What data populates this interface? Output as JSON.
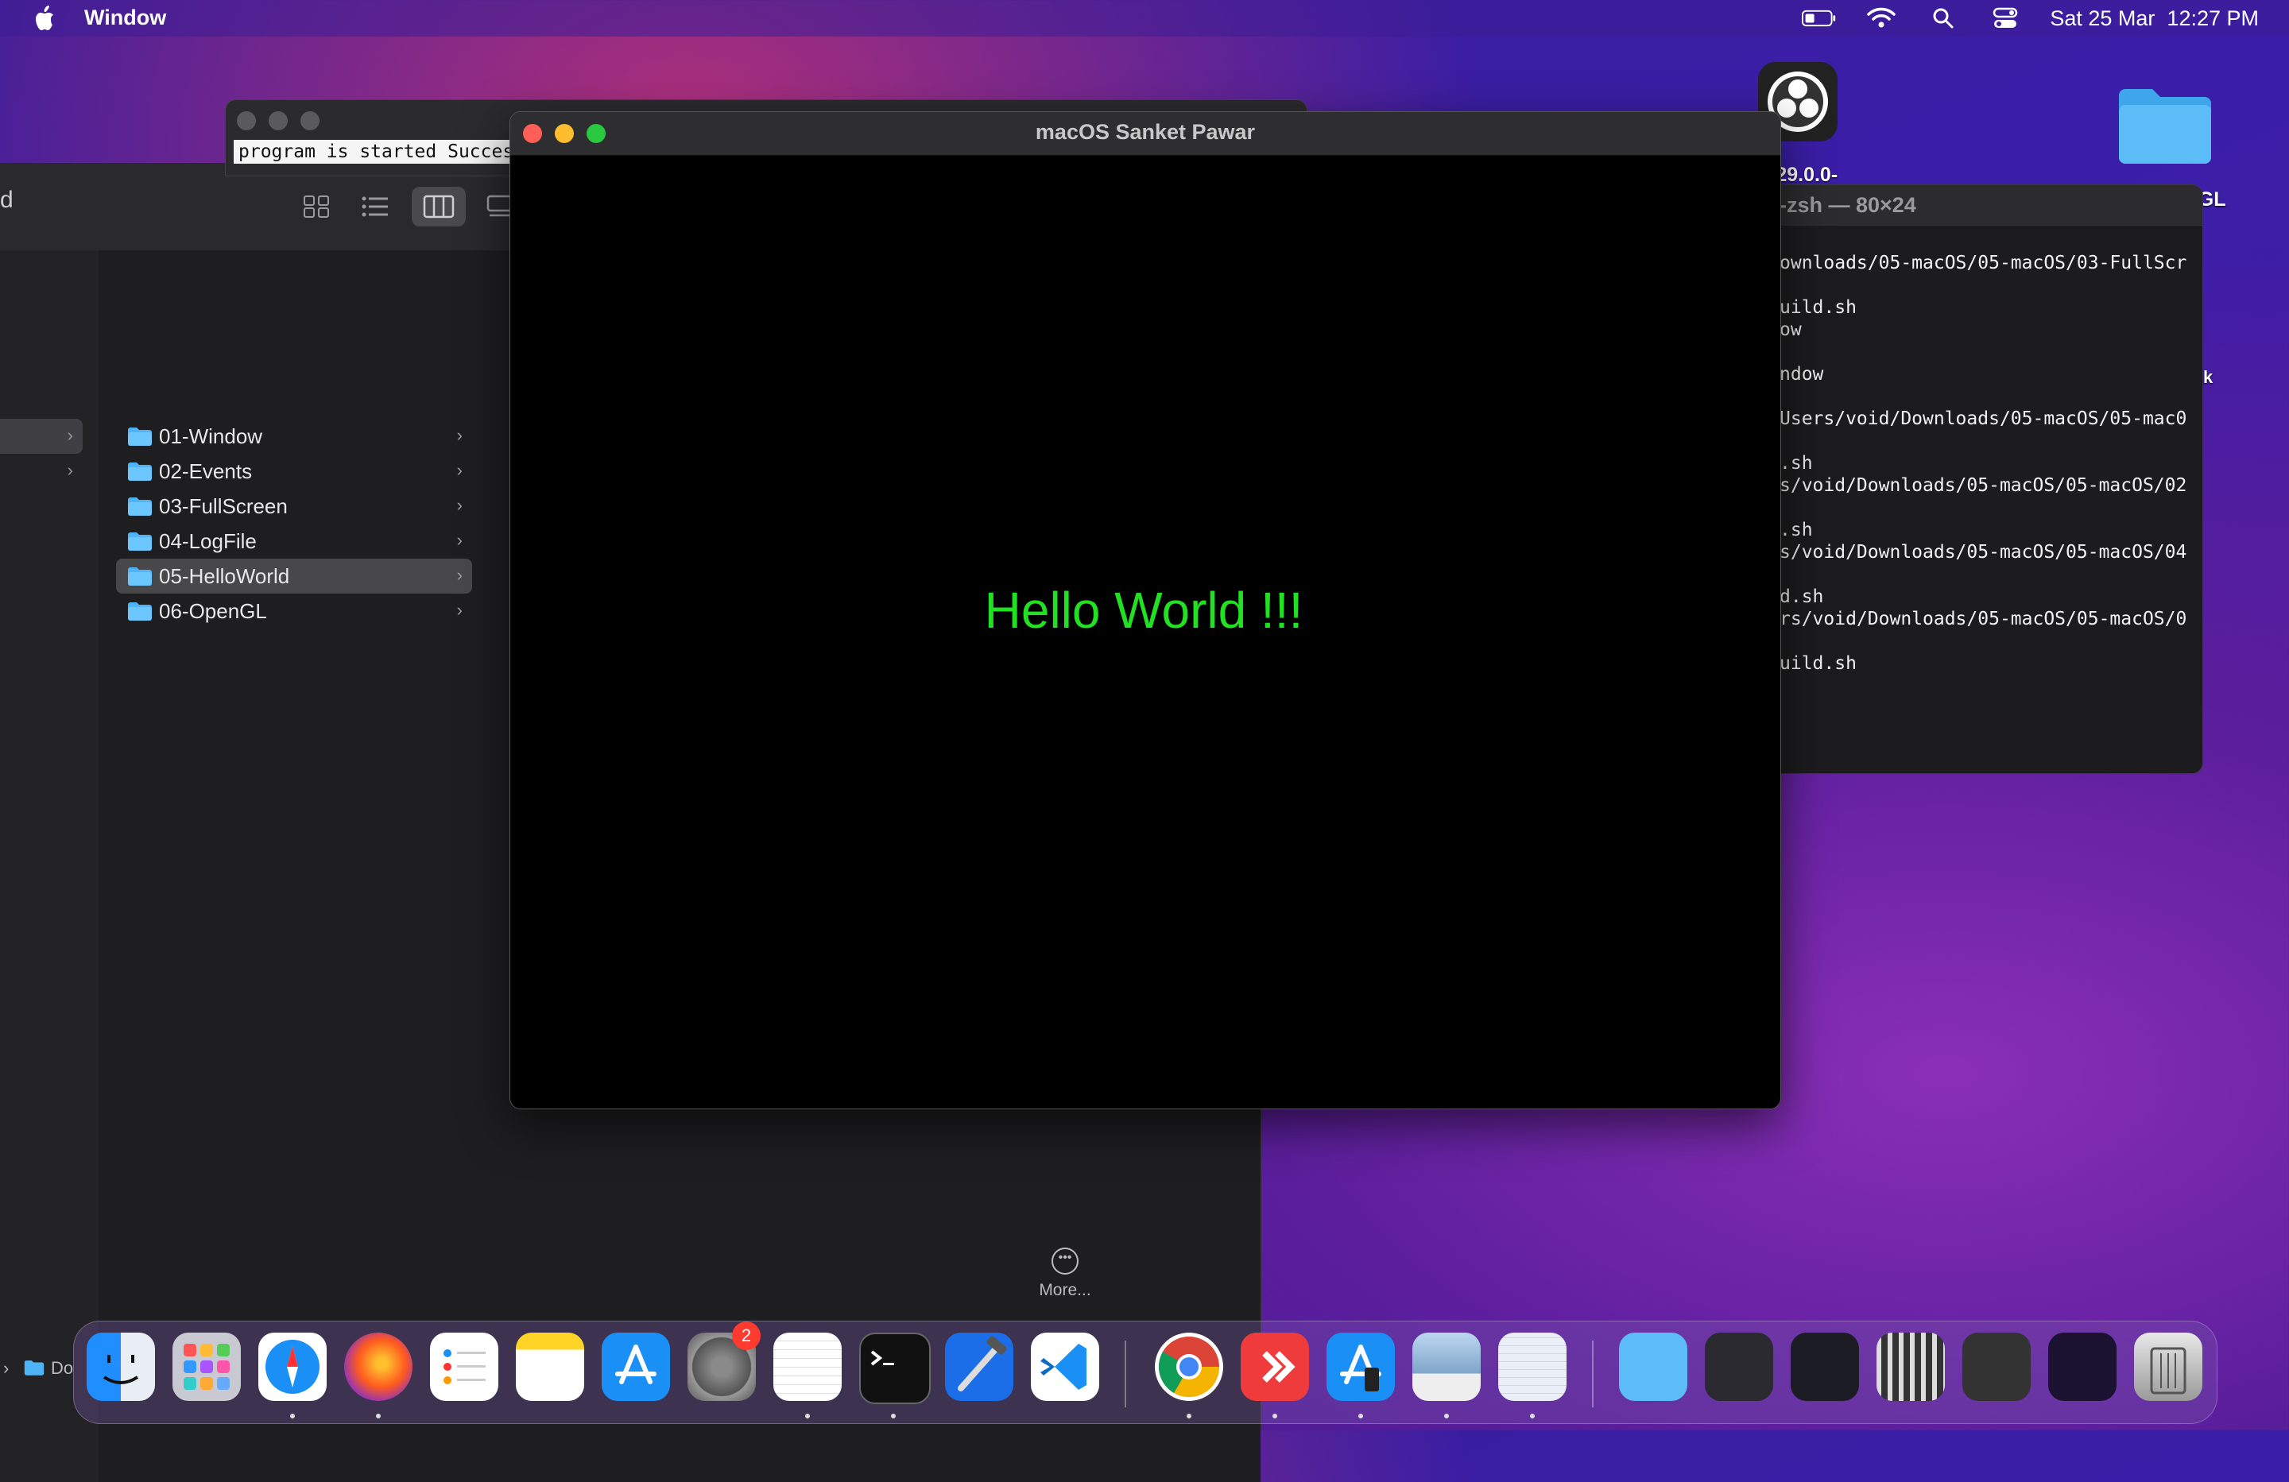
{
  "menubar": {
    "app_name": "Window",
    "datetime": "Sat 25 Mar  12:27 PM"
  },
  "console": {
    "text": "program is started Success"
  },
  "finder": {
    "folders": [
      {
        "label": "01-Window"
      },
      {
        "label": "02-Events"
      },
      {
        "label": "03-FullScreen"
      },
      {
        "label": "04-LogFile"
      },
      {
        "label": "05-HelloWorld"
      },
      {
        "label": "06-OpenGL"
      }
    ],
    "selected_folder": "05-HelloWorld",
    "more_label": "More...",
    "path_fragment": "Do"
  },
  "terminal": {
    "title": "-zsh — 80×24",
    "lines": [
      "ownloads/05-macOS/05-macOS/03-FullScr",
      "uild.sh",
      "ow",
      "ndow",
      "Users/void/Downloads/05-macOS/05-mac0",
      ".sh",
      "s/void/Downloads/05-macOS/05-macOS/02",
      ".sh",
      "s/void/Downloads/05-macOS/05-macOS/04",
      "d.sh",
      "rs/void/Downloads/05-macOS/05-macOS/0",
      "uild.sh"
    ]
  },
  "desktop": {
    "obs_label": "-29.0.0-",
    "folder_label": "-OGL",
    "k_label": "k"
  },
  "appwin": {
    "title": "macOS Sanket Pawar",
    "message": "Hello World !!!"
  },
  "dock": {
    "settings_badge": "2"
  },
  "colors": {
    "hello_text": "#22e022",
    "close": "#ff5f57",
    "minimize": "#febc2e",
    "zoom": "#28c840"
  }
}
